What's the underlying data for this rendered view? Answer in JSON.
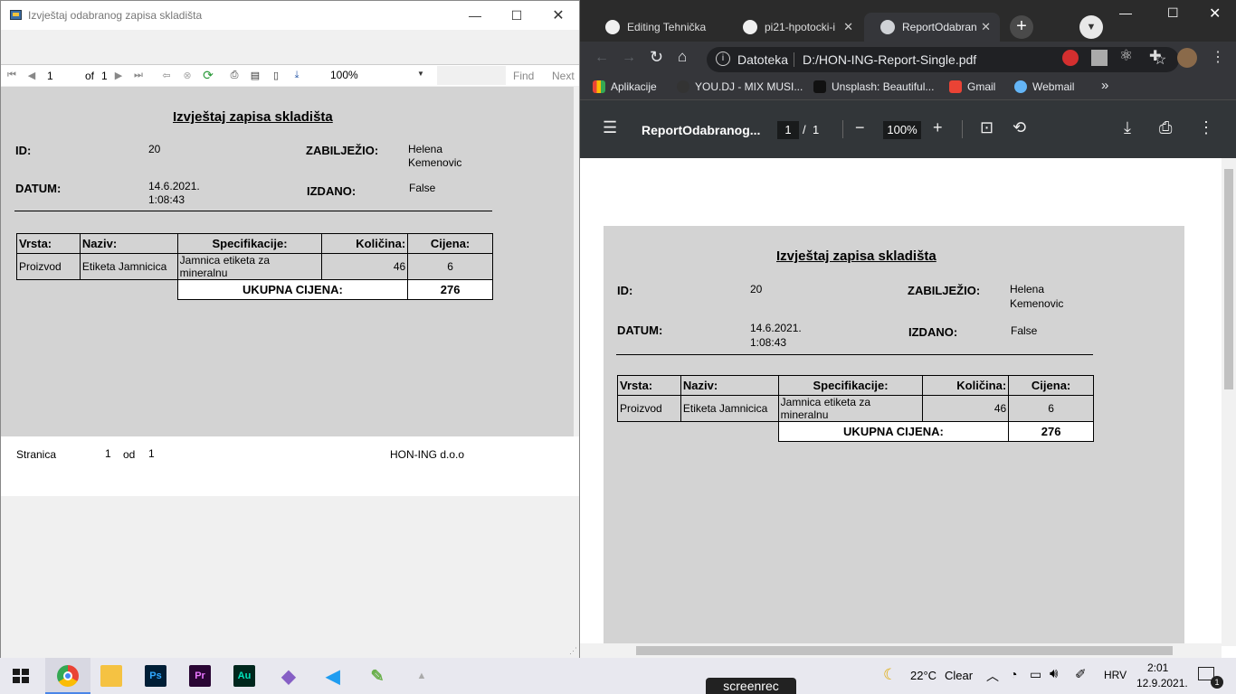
{
  "left_window": {
    "title": "Izvještaj odabranog zapisa skladišta",
    "controls": {
      "minimize": "—",
      "maximize": "☐",
      "close": "✕"
    },
    "toolbar": {
      "page_value": "1",
      "of_label": "of",
      "total_pages": "1",
      "zoom": "100%",
      "find": "Find",
      "next": "Next"
    },
    "footer": {
      "page_label": "Stranica",
      "page_num": "1",
      "of_label": "od",
      "page_total": "1",
      "company": "HON-ING d.o.o"
    }
  },
  "report": {
    "title": "Izvještaj zapisa skladišta",
    "id_label": "ID:",
    "id_value": "20",
    "recorded_label": "ZABILJEŽIO:",
    "recorded_value_line1": "Helena",
    "recorded_value_line2": "Kemenovic",
    "date_label": "DATUM:",
    "date_value_line1": "14.6.2021.",
    "date_value_line2": "1:08:43",
    "issued_label": "IZDANO:",
    "issued_value": "False",
    "columns": [
      "Vrsta:",
      "Naziv:",
      "Specifikacije:",
      "Količina:",
      "Cijena:"
    ],
    "rows": [
      [
        "Proizvod",
        "Etiketa Jamnicica",
        "Jamnica etiketa za mineralnu",
        "46",
        "6"
      ]
    ],
    "total_label": "UKUPNA CIJENA:",
    "total_value": "276"
  },
  "browser": {
    "tabs": [
      {
        "label": "Editing Tehnička"
      },
      {
        "label": "pi21-hpotocki-i"
      },
      {
        "label": "ReportOdabran"
      }
    ],
    "new_tab": "+",
    "address_prefix": "Datoteka",
    "address": "D:/HON-ING-Report-Single.pdf",
    "bookmarks": [
      "Aplikacije",
      "YOU.DJ - MIX MUSI...",
      "Unsplash: Beautiful...",
      "Gmail",
      "Webmail"
    ],
    "bookmarks_more": "»",
    "pdf": {
      "doc_title": "ReportOdabranog...",
      "page": "1",
      "sep": "/",
      "pages": "1",
      "zoom": "100%"
    }
  },
  "taskbar": {
    "weather": "22°C",
    "weather_desc": "Clear",
    "language": "HRV",
    "time": "2:01",
    "date": "12.9.2021.",
    "notifications": "1",
    "screenrec": "screenrec",
    "apps": [
      "Chrome",
      "File Explorer",
      "Photoshop",
      "Premiere",
      "Audition",
      "Visual Studio",
      "VS Code",
      "Paint"
    ]
  }
}
